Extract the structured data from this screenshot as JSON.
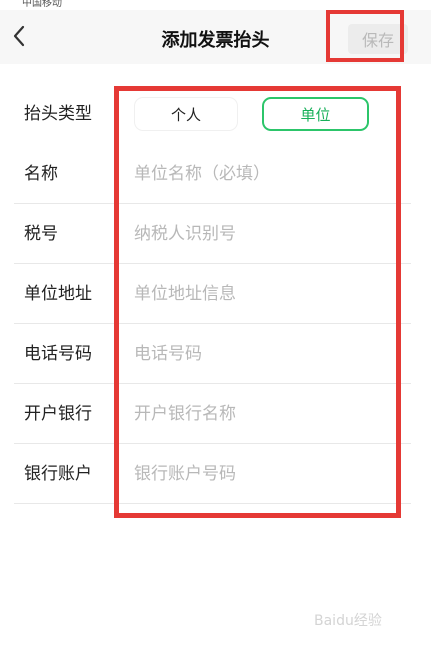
{
  "status_bar": {
    "carrier": "中国移动"
  },
  "header": {
    "title": "添加发票抬头",
    "save_label": "保存"
  },
  "form": {
    "type_row": {
      "label": "抬头类型",
      "options": [
        "个人",
        "单位"
      ],
      "selected": "单位"
    },
    "fields": [
      {
        "label": "名称",
        "placeholder": "单位名称（必填）"
      },
      {
        "label": "税号",
        "placeholder": "纳税人识别号"
      },
      {
        "label": "单位地址",
        "placeholder": "单位地址信息"
      },
      {
        "label": "电话号码",
        "placeholder": "电话号码"
      },
      {
        "label": "开户银行",
        "placeholder": "开户银行名称"
      },
      {
        "label": "银行账户",
        "placeholder": "银行账户号码"
      }
    ]
  },
  "watermark": "Baidu经验",
  "colors": {
    "accent": "#2cc56a",
    "highlight": "#e53935"
  },
  "icons": {
    "back": "chevron-left-icon"
  }
}
